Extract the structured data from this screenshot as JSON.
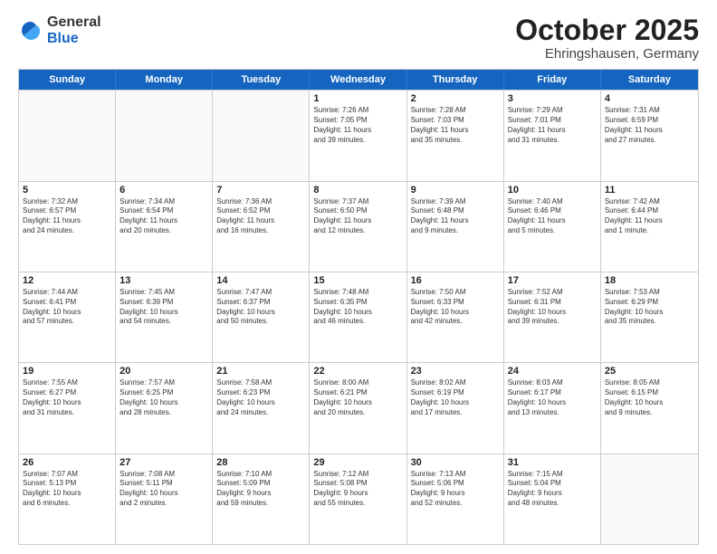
{
  "logo": {
    "general": "General",
    "blue": "Blue"
  },
  "title": "October 2025",
  "subtitle": "Ehringshausen, Germany",
  "days": [
    "Sunday",
    "Monday",
    "Tuesday",
    "Wednesday",
    "Thursday",
    "Friday",
    "Saturday"
  ],
  "weeks": [
    [
      {
        "day": "",
        "info": ""
      },
      {
        "day": "",
        "info": ""
      },
      {
        "day": "",
        "info": ""
      },
      {
        "day": "1",
        "info": "Sunrise: 7:26 AM\nSunset: 7:05 PM\nDaylight: 11 hours\nand 39 minutes."
      },
      {
        "day": "2",
        "info": "Sunrise: 7:28 AM\nSunset: 7:03 PM\nDaylight: 11 hours\nand 35 minutes."
      },
      {
        "day": "3",
        "info": "Sunrise: 7:29 AM\nSunset: 7:01 PM\nDaylight: 11 hours\nand 31 minutes."
      },
      {
        "day": "4",
        "info": "Sunrise: 7:31 AM\nSunset: 6:59 PM\nDaylight: 11 hours\nand 27 minutes."
      }
    ],
    [
      {
        "day": "5",
        "info": "Sunrise: 7:32 AM\nSunset: 6:57 PM\nDaylight: 11 hours\nand 24 minutes."
      },
      {
        "day": "6",
        "info": "Sunrise: 7:34 AM\nSunset: 6:54 PM\nDaylight: 11 hours\nand 20 minutes."
      },
      {
        "day": "7",
        "info": "Sunrise: 7:36 AM\nSunset: 6:52 PM\nDaylight: 11 hours\nand 16 minutes."
      },
      {
        "day": "8",
        "info": "Sunrise: 7:37 AM\nSunset: 6:50 PM\nDaylight: 11 hours\nand 12 minutes."
      },
      {
        "day": "9",
        "info": "Sunrise: 7:39 AM\nSunset: 6:48 PM\nDaylight: 11 hours\nand 9 minutes."
      },
      {
        "day": "10",
        "info": "Sunrise: 7:40 AM\nSunset: 6:46 PM\nDaylight: 11 hours\nand 5 minutes."
      },
      {
        "day": "11",
        "info": "Sunrise: 7:42 AM\nSunset: 6:44 PM\nDaylight: 11 hours\nand 1 minute."
      }
    ],
    [
      {
        "day": "12",
        "info": "Sunrise: 7:44 AM\nSunset: 6:41 PM\nDaylight: 10 hours\nand 57 minutes."
      },
      {
        "day": "13",
        "info": "Sunrise: 7:45 AM\nSunset: 6:39 PM\nDaylight: 10 hours\nand 54 minutes."
      },
      {
        "day": "14",
        "info": "Sunrise: 7:47 AM\nSunset: 6:37 PM\nDaylight: 10 hours\nand 50 minutes."
      },
      {
        "day": "15",
        "info": "Sunrise: 7:48 AM\nSunset: 6:35 PM\nDaylight: 10 hours\nand 46 minutes."
      },
      {
        "day": "16",
        "info": "Sunrise: 7:50 AM\nSunset: 6:33 PM\nDaylight: 10 hours\nand 42 minutes."
      },
      {
        "day": "17",
        "info": "Sunrise: 7:52 AM\nSunset: 6:31 PM\nDaylight: 10 hours\nand 39 minutes."
      },
      {
        "day": "18",
        "info": "Sunrise: 7:53 AM\nSunset: 6:29 PM\nDaylight: 10 hours\nand 35 minutes."
      }
    ],
    [
      {
        "day": "19",
        "info": "Sunrise: 7:55 AM\nSunset: 6:27 PM\nDaylight: 10 hours\nand 31 minutes."
      },
      {
        "day": "20",
        "info": "Sunrise: 7:57 AM\nSunset: 6:25 PM\nDaylight: 10 hours\nand 28 minutes."
      },
      {
        "day": "21",
        "info": "Sunrise: 7:58 AM\nSunset: 6:23 PM\nDaylight: 10 hours\nand 24 minutes."
      },
      {
        "day": "22",
        "info": "Sunrise: 8:00 AM\nSunset: 6:21 PM\nDaylight: 10 hours\nand 20 minutes."
      },
      {
        "day": "23",
        "info": "Sunrise: 8:02 AM\nSunset: 6:19 PM\nDaylight: 10 hours\nand 17 minutes."
      },
      {
        "day": "24",
        "info": "Sunrise: 8:03 AM\nSunset: 6:17 PM\nDaylight: 10 hours\nand 13 minutes."
      },
      {
        "day": "25",
        "info": "Sunrise: 8:05 AM\nSunset: 6:15 PM\nDaylight: 10 hours\nand 9 minutes."
      }
    ],
    [
      {
        "day": "26",
        "info": "Sunrise: 7:07 AM\nSunset: 5:13 PM\nDaylight: 10 hours\nand 6 minutes."
      },
      {
        "day": "27",
        "info": "Sunrise: 7:08 AM\nSunset: 5:11 PM\nDaylight: 10 hours\nand 2 minutes."
      },
      {
        "day": "28",
        "info": "Sunrise: 7:10 AM\nSunset: 5:09 PM\nDaylight: 9 hours\nand 59 minutes."
      },
      {
        "day": "29",
        "info": "Sunrise: 7:12 AM\nSunset: 5:08 PM\nDaylight: 9 hours\nand 55 minutes."
      },
      {
        "day": "30",
        "info": "Sunrise: 7:13 AM\nSunset: 5:06 PM\nDaylight: 9 hours\nand 52 minutes."
      },
      {
        "day": "31",
        "info": "Sunrise: 7:15 AM\nSunset: 5:04 PM\nDaylight: 9 hours\nand 48 minutes."
      },
      {
        "day": "",
        "info": ""
      }
    ]
  ]
}
